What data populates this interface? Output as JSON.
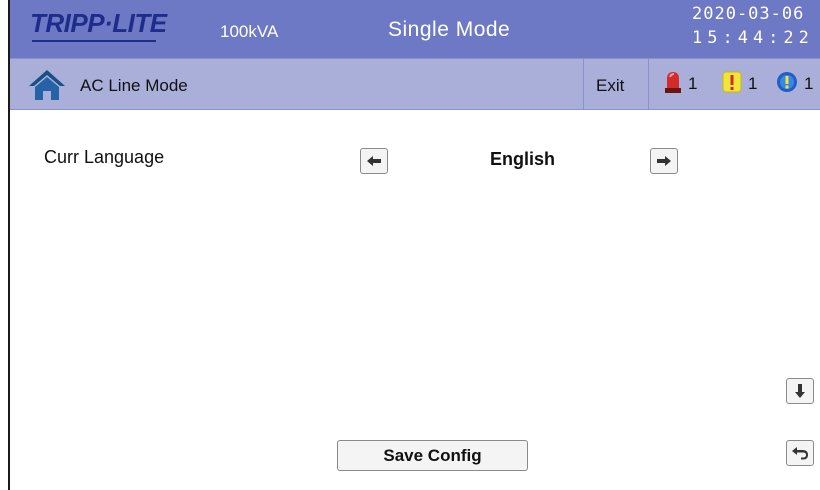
{
  "header": {
    "logo_text": "TRIPP·LITE",
    "capacity": "100kVA",
    "mode": "Single Mode",
    "date": "2020-03-06",
    "time": "15:44:22"
  },
  "statusbar": {
    "label": "AC Line Mode",
    "exit_label": "Exit",
    "alarms": [
      {
        "icon": "red-beacon-icon",
        "count": "1"
      },
      {
        "icon": "yellow-warning-icon",
        "count": "1"
      },
      {
        "icon": "blue-info-icon",
        "count": "1"
      }
    ]
  },
  "settings": {
    "language_label": "Curr Language",
    "language_value": "English"
  },
  "footer": {
    "save_label": "Save Config"
  },
  "colors": {
    "header_bg": "#6d79c4",
    "statusbar_bg": "#a9afd9",
    "logo_blue": "#1f2d8a"
  }
}
